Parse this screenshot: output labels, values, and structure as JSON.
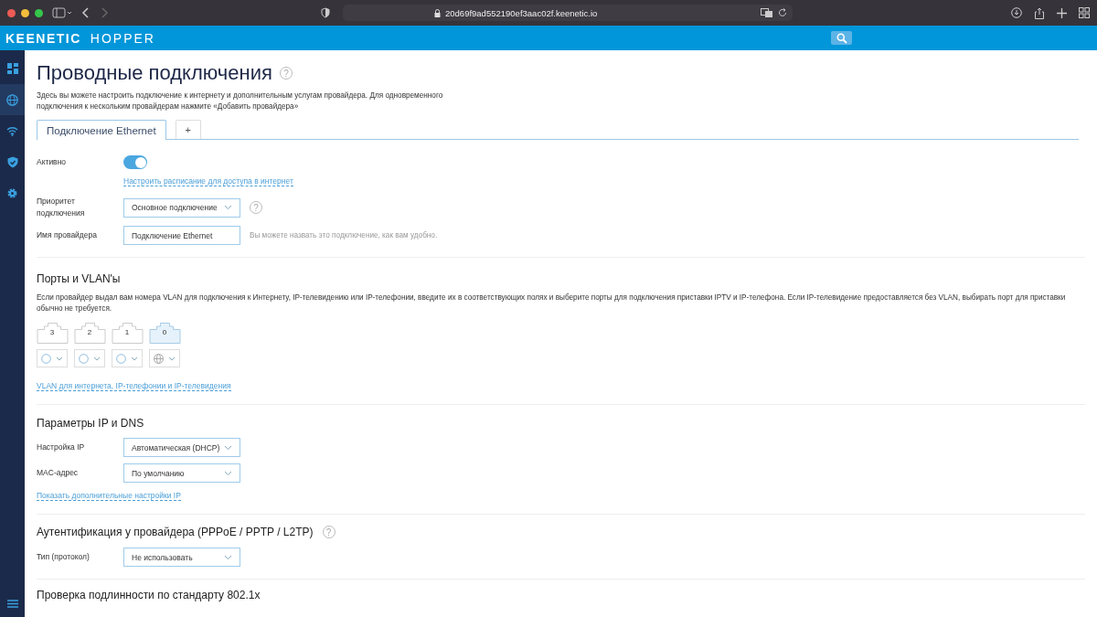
{
  "browser": {
    "url": "20d69f9ad552190ef3aac02f.keenetic.io"
  },
  "header": {
    "brand": "KEENETIC",
    "product": "HOPPER"
  },
  "sidebar": {
    "items": [
      {
        "kind": "dashboard",
        "selected": false
      },
      {
        "kind": "globe",
        "selected": true
      },
      {
        "kind": "wifi",
        "selected": false
      },
      {
        "kind": "shield",
        "selected": false
      },
      {
        "kind": "gear",
        "selected": false
      }
    ]
  },
  "page": {
    "title": "Проводные подключения",
    "help": "?",
    "description": "Здесь вы можете настроить подключение к интернету и дополнительным услугам провайдера. Для одновременного подключения к нескольким провайдерам нажмите «Добавить провайдера»"
  },
  "tabs": [
    {
      "label": "Подключение Ethernet",
      "selected": true
    },
    {
      "label": "+",
      "selected": false
    }
  ],
  "general": {
    "active_label": "Активно",
    "active_on": true,
    "schedule_link": "Настроить расписание для доступа в интернет",
    "priority_label": "Приоритет подключения",
    "priority_value": "Основное подключение",
    "priority_help": "?",
    "name_label": "Имя провайдера",
    "name_value": "Подключение Ethernet",
    "name_hint": "Вы можете назвать это подключение, как вам удобно."
  },
  "ports_section": {
    "title": "Порты и VLAN'ы",
    "description": "Если провайдер выдал вам номера VLAN для подключения к Интернету, IP-телевидению или IP-телефонии, введите их в соответствующих полях и выберите порты для подключения приставки IPTV и IP-телефона. Если IP-телевидение предоставляется без VLAN, выбирать порт для приставки обычно не требуется.",
    "ports": [
      {
        "label": "3",
        "selected": false,
        "kind": "none"
      },
      {
        "label": "2",
        "selected": false,
        "kind": "none"
      },
      {
        "label": "1",
        "selected": false,
        "kind": "none"
      },
      {
        "label": "0",
        "selected": true,
        "kind": "internet"
      }
    ],
    "link": "VLAN для интернета, IP-телефонии и IP-телевидения"
  },
  "ip_section": {
    "title": "Параметры IP и DNS",
    "fields": [
      {
        "label": "Настройка IP",
        "value": "Автоматическая (DHCP)"
      },
      {
        "label": "MAC-адрес",
        "value": "По умолчанию"
      }
    ],
    "link": "Показать дополнительные настройки IP"
  },
  "auth_section": {
    "title": "Аутентификация у провайдера (PPPoE / PPTP / L2TP)",
    "help": "?",
    "type_label": "Тип (протокол)",
    "type_value": "Не использовать"
  },
  "dot1x_section": {
    "title": "Проверка подлинности по стандарту 802.1x"
  }
}
